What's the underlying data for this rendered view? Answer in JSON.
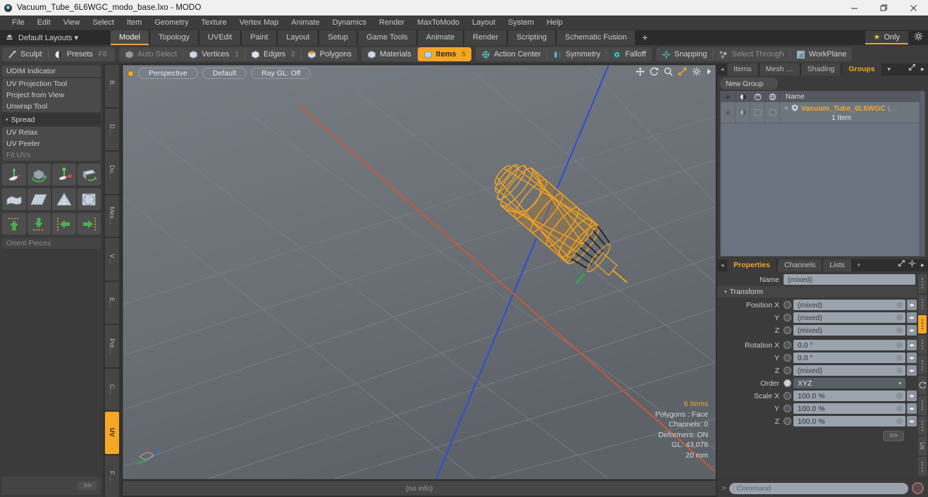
{
  "titlebar": {
    "title": "Vacuum_Tube_6L6WGC_modo_base.lxo - MODO",
    "minimize": "—",
    "maximize": "❐",
    "close": "×"
  },
  "menubar": {
    "items": [
      "File",
      "Edit",
      "View",
      "Select",
      "Item",
      "Geometry",
      "Texture",
      "Vertex Map",
      "Animate",
      "Dynamics",
      "Render",
      "MaxToModo",
      "Layout",
      "System",
      "Help"
    ]
  },
  "layoutbar": {
    "layouts_label": "Default Layouts",
    "layouts_caret": "▾",
    "tabs": [
      {
        "label": "Model",
        "active": true
      },
      {
        "label": "Topology",
        "active": false
      },
      {
        "label": "UVEdit",
        "active": false
      },
      {
        "label": "Paint",
        "active": false
      },
      {
        "label": "Layout",
        "active": false
      },
      {
        "label": "Setup",
        "active": false
      },
      {
        "label": "Game Tools",
        "active": false
      },
      {
        "label": "Animate",
        "active": false
      },
      {
        "label": "Render",
        "active": false
      },
      {
        "label": "Scripting",
        "active": false
      },
      {
        "label": "Schematic Fusion",
        "active": false
      }
    ],
    "plus": "+",
    "only_label": "Only",
    "star": "★"
  },
  "modebar": {
    "sculpt": "Sculpt",
    "presets": "Presets",
    "presets_key": "F6",
    "auto_select": "Auto Select",
    "vertices": "Vertices",
    "vertices_num": "1",
    "edges": "Edges",
    "edges_num": "2",
    "polygons": "Polygons",
    "materials": "Materials",
    "items": "Items",
    "items_num": "5",
    "action_center": "Action Center",
    "symmetry": "Symmetry",
    "falloff": "Falloff",
    "snapping": "Snapping",
    "select_through": "Select Through",
    "workplane": "WorkPlane"
  },
  "leftpanel": {
    "udim": "UDIM Indicator",
    "uv_projection_tool": "UV Projection Tool",
    "project_from_view": "Project from View",
    "unwrap_tool": "Unwrap Tool",
    "spread": "Spread",
    "uv_relax": "UV Relax",
    "uv_peeler": "UV Peeler",
    "fit_uvs": "Fit UVs",
    "orient_pieces": "Orient Pieces",
    "more": ">>",
    "vtabs": [
      "B…",
      "D…",
      "Du…",
      "Mes…",
      "V…",
      "E…",
      "Pol…",
      "C…",
      "UV",
      "F…"
    ],
    "vtab_active": "UV"
  },
  "viewport": {
    "perspective": "Perspective",
    "shading": "Default",
    "raygl": "Ray GL: Off",
    "stats": {
      "items": "6 Items",
      "polygons": "Polygons : Face",
      "channels": "Channels: 0",
      "deformers": "Deformers: ON",
      "gl": "GL: 43,076",
      "scale": "20 mm"
    },
    "footer": "(no info)"
  },
  "rightpanel": {
    "top_tabs": [
      {
        "label": "Items",
        "active": false
      },
      {
        "label": "Mesh …",
        "active": false
      },
      {
        "label": "Shading",
        "active": false
      },
      {
        "label": "Groups",
        "active": true
      }
    ],
    "new_group": "New Group",
    "list_header_name": "Name",
    "group_item": {
      "name": "Vacuum_Tube_6L6WGC",
      "suffix": "(…",
      "count": "1 Item",
      "plus": "+"
    }
  },
  "properties": {
    "tabs": [
      {
        "label": "Properties",
        "active": true
      },
      {
        "label": "Channels",
        "active": false
      },
      {
        "label": "Lists",
        "active": false
      }
    ],
    "plus": "+",
    "name_label": "Name",
    "name_value": "(mixed)",
    "transform_section": "Transform",
    "rows": [
      {
        "label": "Position X",
        "value": "(mixed)"
      },
      {
        "label": "Y",
        "value": "(mixed)"
      },
      {
        "label": "Z",
        "value": "(mixed)"
      },
      {
        "label": "Rotation X",
        "value": "0.0 °"
      },
      {
        "label": "Y",
        "value": "0.0 °"
      },
      {
        "label": "Z",
        "value": "(mixed)"
      }
    ],
    "order_label": "Order",
    "order_value": "XYZ",
    "scale_rows": [
      {
        "label": "Scale X",
        "value": "100.0 %"
      },
      {
        "label": "Y",
        "value": "100.0 %"
      },
      {
        "label": "Z",
        "value": "100.0 %"
      }
    ],
    "more": ">>"
  },
  "commandbar": {
    "prompt": ">",
    "placeholder": "Command"
  },
  "colors": {
    "accent": "#f5a623",
    "panel": "#3b3b3b",
    "viewport_bg": "#6d7278",
    "field": "#9ba3ad"
  }
}
